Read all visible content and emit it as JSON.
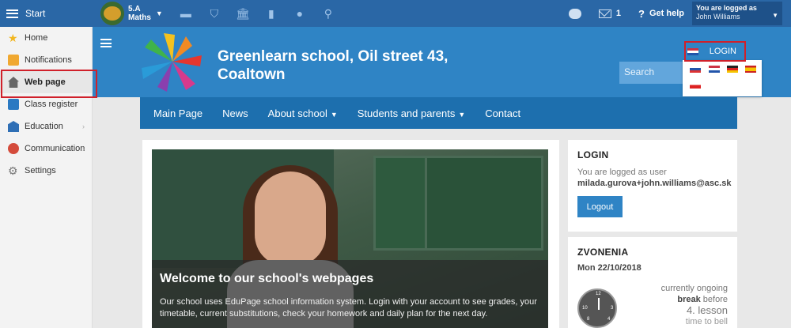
{
  "topbar": {
    "start_label": "Start",
    "class_name": "5.A",
    "subject": "Maths",
    "mail_count": "1",
    "help_label": "Get help",
    "logged_label": "You are logged as",
    "logged_user": "John Williams"
  },
  "sidebar": {
    "items": [
      {
        "label": "Home"
      },
      {
        "label": "Notifications"
      },
      {
        "label": "Web page"
      },
      {
        "label": "Class register"
      },
      {
        "label": "Education"
      },
      {
        "label": "Communication"
      },
      {
        "label": "Settings"
      }
    ]
  },
  "header": {
    "school_line1": "Greenlearn school, Oil street 43,",
    "school_line2": "Coaltown",
    "search_placeholder": "Search",
    "login_label": "LOGIN"
  },
  "nav": {
    "items": [
      {
        "label": "Main Page"
      },
      {
        "label": "News"
      },
      {
        "label": "About school"
      },
      {
        "label": "Students and parents"
      },
      {
        "label": "Contact"
      }
    ]
  },
  "hero": {
    "title": "Welcome to our school's webpages",
    "text": "Our school uses EduPage school information system. Login with your account to see grades, your timetable, current substitutions, check your homework and daily plan for the next day."
  },
  "login_widget": {
    "title": "LOGIN",
    "logged_as": "You are logged as user",
    "user_email": "milada.gurova+john.williams@asc.sk",
    "logout_label": "Logout"
  },
  "bell_widget": {
    "title": "ZVONENIA",
    "date": "Mon 22/10/2018",
    "status": "currently ongoing",
    "break_word": "break",
    "before_word": "before",
    "lesson": "4. lesson",
    "bell_text": "time to bell"
  },
  "colors": {
    "topbar": "#2a67a6",
    "header": "#2f84c5",
    "nav": "#1d6fae",
    "highlight": "#d0202a"
  }
}
